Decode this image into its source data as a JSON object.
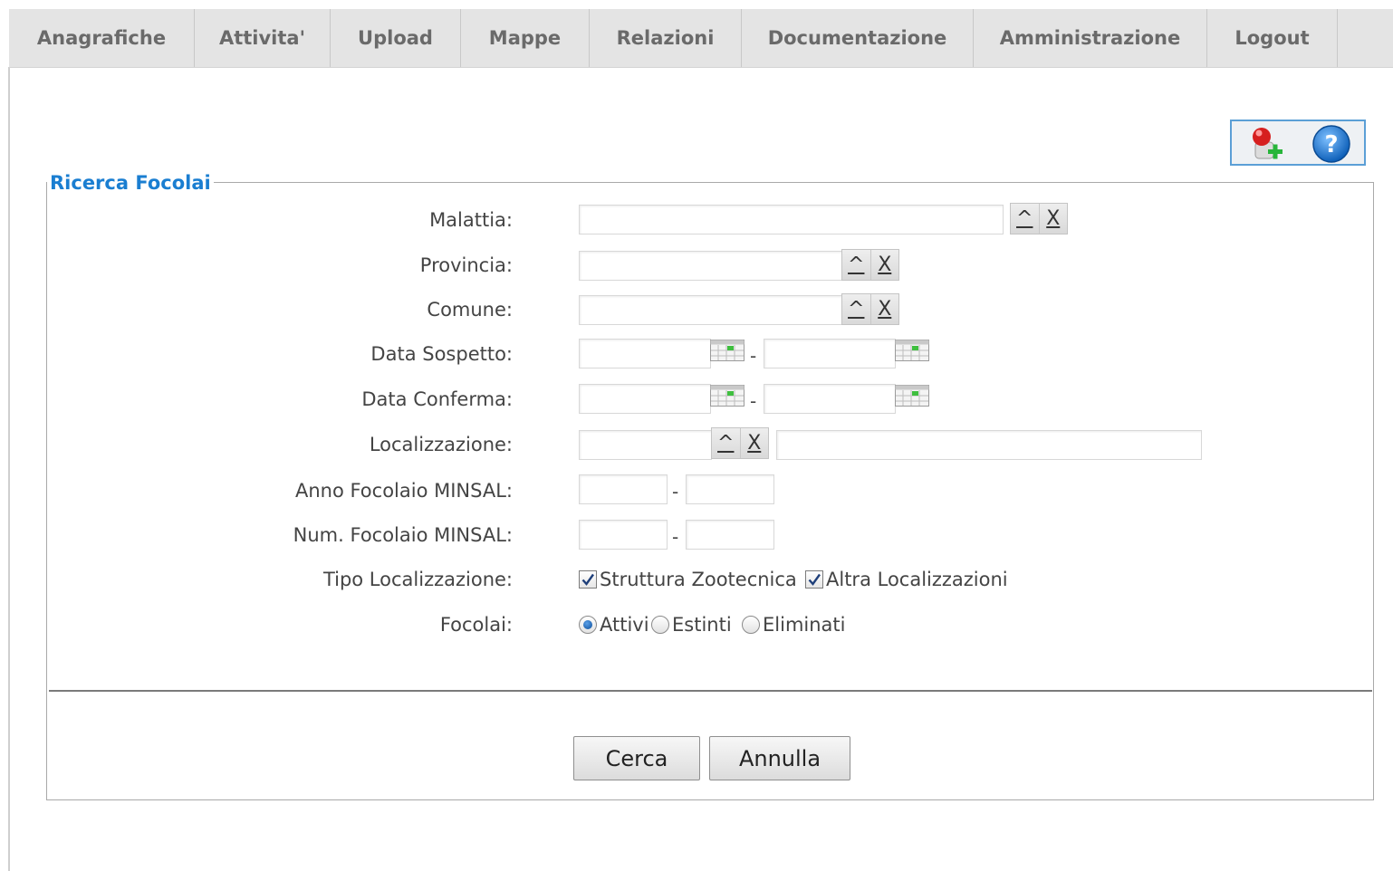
{
  "nav": [
    {
      "label": "Anagrafiche"
    },
    {
      "label": "Attivita'"
    },
    {
      "label": "Upload"
    },
    {
      "label": "Mappe"
    },
    {
      "label": "Relazioni"
    },
    {
      "label": "Documentazione"
    },
    {
      "label": "Amministrazione"
    },
    {
      "label": "Logout"
    }
  ],
  "toolbar": {
    "add_icon": "add-user-icon",
    "help_icon": "help-icon"
  },
  "form": {
    "legend": "Ricerca Focolai",
    "labels": {
      "malattia": "Malattia:",
      "provincia": "Provincia:",
      "comune": "Comune:",
      "data_sospetto": "Data Sospetto:",
      "data_conferma": "Data Conferma:",
      "localizzazione": "Localizzazione:",
      "anno_focolaio": "Anno Focolaio MINSAL:",
      "num_focolaio": "Num. Focolaio MINSAL:",
      "tipo_localizzazione": "Tipo Localizzazione:",
      "focolai": "Focolai:"
    },
    "lookup_open": "^",
    "lookup_clear": "X",
    "range_sep": "-",
    "tipo_options": [
      {
        "label": "Struttura Zootecnica",
        "checked": true
      },
      {
        "label": "Altra Localizzazioni",
        "checked": true
      }
    ],
    "focolai_options": [
      {
        "label": "Attivi",
        "selected": true
      },
      {
        "label": "Estinti",
        "selected": false
      },
      {
        "label": "Eliminati",
        "selected": false
      }
    ]
  },
  "buttons": {
    "search": "Cerca",
    "cancel": "Annulla"
  },
  "colors": {
    "accent": "#1a7ed1",
    "nav_bg": "#e4e4e4",
    "toolbar_border": "#5b9fd6"
  }
}
